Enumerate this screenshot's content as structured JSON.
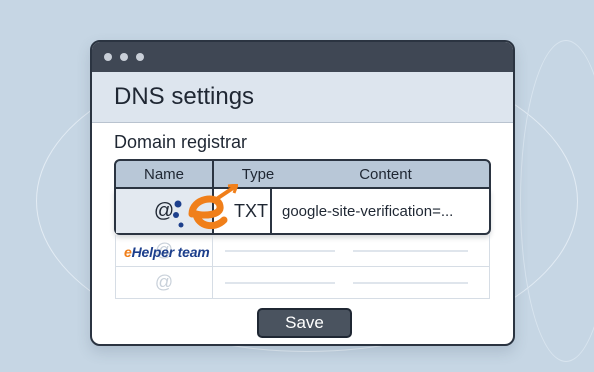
{
  "window": {
    "title": "DNS settings"
  },
  "section": {
    "label": "Domain registrar"
  },
  "table": {
    "columns": [
      "Name",
      "Type",
      "Content"
    ],
    "row": {
      "name": "@",
      "type": "TXT",
      "content": "google-site-verification=..."
    },
    "ghost_rows": [
      {
        "name": "@"
      },
      {
        "name": "@"
      }
    ]
  },
  "actions": {
    "save_label": "Save"
  },
  "watermark": {
    "prefix": "e",
    "text": "Helper team"
  },
  "colors": {
    "background": "#c6d6e4",
    "titlebar": "#3f4754",
    "header": "#dde5ee",
    "table_header": "#b8c7d7",
    "button": "#4a535f",
    "logo_orange": "#f07f1a",
    "logo_blue": "#1d3f8c"
  }
}
